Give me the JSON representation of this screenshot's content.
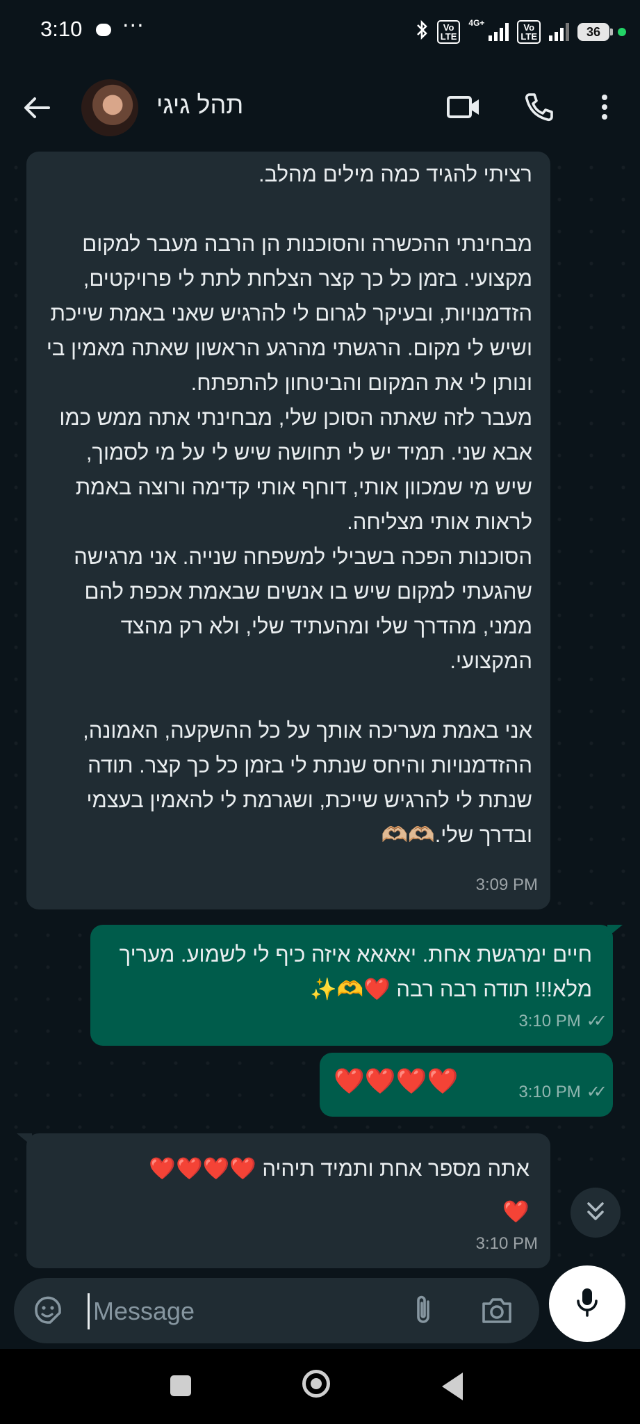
{
  "status_bar": {
    "time": "3:10",
    "more_indicator": "···",
    "network_label": "4G+",
    "volte_label_1": "Vo\nLTE",
    "volte_label_2": "Vo\nLTE",
    "battery": "36"
  },
  "header": {
    "contact_name": "תהל גיגי"
  },
  "messages": [
    {
      "direction": "incoming",
      "text": "רציתי להגיד כמה מילים מהלב.\n\nמבחינתי ההכשרה והסוכנות הן הרבה מעבר למקום מקצועי. בזמן כל כך קצר הצלחת לתת לי פרויקטים, הזדמנויות, ובעיקר לגרום לי להרגיש שאני באמת שייכת ושיש לי מקום. הרגשתי מהרגע הראשון שאתה מאמין בי ונותן לי את המקום והביטחון להתפתח.\nמעבר לזה שאתה הסוכן שלי, מבחינתי אתה ממש כמו אבא שני. תמיד יש לי תחושה שיש לי על מי לסמוך, שיש מי שמכוון אותי, דוחף אותי קדימה ורוצה באמת לראות אותי מצליחה.\nהסוכנות הפכה בשבילי למשפחה שנייה. אני מרגישה שהגעתי למקום שיש בו אנשים שבאמת אכפת להם ממני, מהדרך שלי ומהעתיד שלי, ולא רק מהצד המקצועי.\n\nאני באמת מעריכה אותך על כל ההשקעה, האמונה, ההזדמנויות והיחס שנתת לי בזמן כל כך קצר. תודה שנתת לי להרגיש שייכת, ושגרמת לי להאמין בעצמי ובדרך שלי.🫶🏼🫶🏼",
      "time": "3:09 PM"
    },
    {
      "direction": "outgoing",
      "text": "חיים ימרגשת אחת. יאאאא איזה כיף לי לשמוע. מעריך מלא!!! תודה רבה רבה ❤️🫶✨",
      "time": "3:10 PM",
      "status": "read"
    },
    {
      "direction": "outgoing",
      "text": "❤️❤️❤️❤️",
      "time": "3:10 PM",
      "status": "read"
    },
    {
      "direction": "incoming",
      "text": "אתה מספר אחת ותמיד תיהיה ❤️❤️❤️❤️\n❤️",
      "time": "3:10 PM"
    }
  ],
  "composer": {
    "placeholder": "Message"
  },
  "colors": {
    "background": "#0b141a",
    "incoming_bubble": "#202c33",
    "outgoing_bubble": "#005c4b",
    "accent_online": "#23d366"
  },
  "icons": [
    "back-arrow-icon",
    "video-call-icon",
    "voice-call-icon",
    "more-options-icon",
    "sticker-icon",
    "attach-icon",
    "camera-icon",
    "mic-icon",
    "scroll-down-icon"
  ]
}
